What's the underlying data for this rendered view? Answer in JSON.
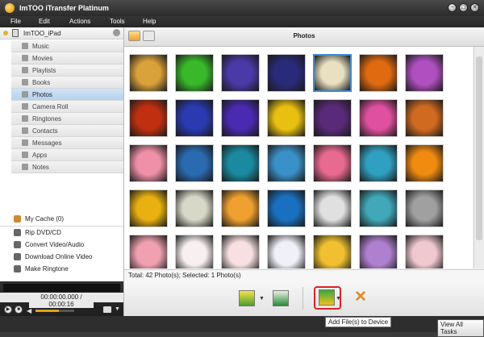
{
  "app": {
    "title": "ImTOO iTransfer Platinum"
  },
  "menu": [
    "File",
    "Edit",
    "Actions",
    "Tools",
    "Help"
  ],
  "window_controls": {
    "minimize": "−",
    "maximize": "□",
    "close": "✕"
  },
  "sidebar": {
    "device": "ImTOO_iPad",
    "items": [
      {
        "label": "Music",
        "icon": "music-icon"
      },
      {
        "label": "Movies",
        "icon": "movie-icon"
      },
      {
        "label": "Playlists",
        "icon": "playlist-icon"
      },
      {
        "label": "Books",
        "icon": "book-icon"
      },
      {
        "label": "Photos",
        "icon": "photo-icon",
        "active": true
      },
      {
        "label": "Camera Roll",
        "icon": "camera-icon"
      },
      {
        "label": "Ringtones",
        "icon": "ringtone-icon"
      },
      {
        "label": "Contacts",
        "icon": "contacts-icon"
      },
      {
        "label": "Messages",
        "icon": "message-icon"
      },
      {
        "label": "Apps",
        "icon": "apps-icon"
      },
      {
        "label": "Notes",
        "icon": "notes-icon"
      }
    ],
    "cache": "My Cache (0)",
    "tools": [
      "Rip DVD/CD",
      "Convert Video/Audio",
      "Download Online Video",
      "Make Ringtone"
    ]
  },
  "player": {
    "time": "00:00:00.000 / 00:00:16",
    "volume": 0.6
  },
  "main": {
    "title": "Photos",
    "status": "Total: 42 Photo(s); Selected: 1 Photo(s)",
    "tooltip": "Add File(s) to Device",
    "view_all": "View All Tasks",
    "selected_index": 4,
    "thumb_colors": [
      "#d9a23a",
      "#39b82a",
      "#4a3aa8",
      "#2a2a7a",
      "#e8e0c0",
      "#e06a10",
      "#b050c0",
      "#c03010",
      "#2a3ab0",
      "#4a2ab0",
      "#e8c010",
      "#5a2a7a",
      "#e050a0",
      "#d06a20",
      "#f090a8",
      "#2a6ab0",
      "#1a8aa0",
      "#3a90c8",
      "#e86a90",
      "#30a0c0",
      "#f08a10",
      "#e8b010",
      "#d8d8c8",
      "#f0a030",
      "#1a70c0",
      "#e0e0e0",
      "#40a8b8",
      "#a0a0a0",
      "#f0a0b0",
      "#f8f0f0",
      "#f8e0e0",
      "#f0f0f8",
      "#f0c030",
      "#b080d0",
      "#f0c8d0"
    ]
  }
}
